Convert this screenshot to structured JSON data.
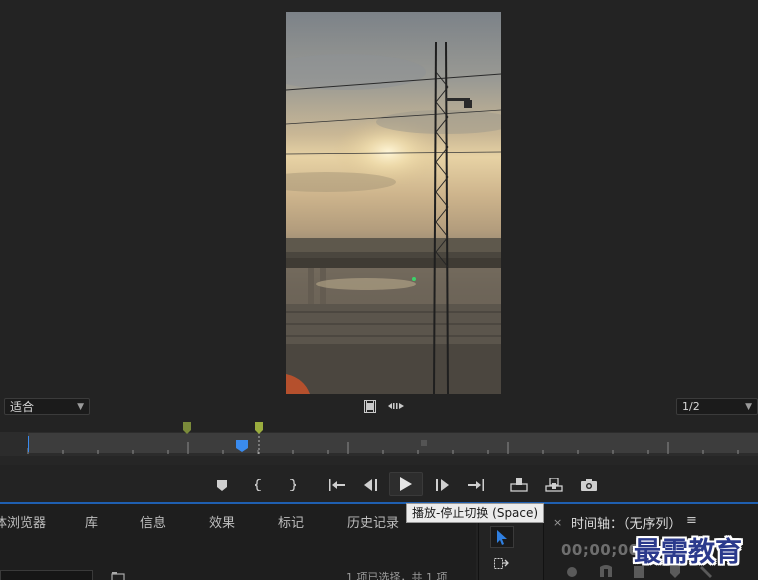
{
  "monitor": {
    "zoom_value": "适合",
    "resolution_value": "1/2"
  },
  "transport": {
    "tooltip": "播放-停止切换 (Space)"
  },
  "project_panel": {
    "tabs": [
      "体浏览器",
      "库",
      "信息",
      "效果",
      "标记",
      "历史记录"
    ],
    "status": "1 项已选择，共 1 项"
  },
  "timeline": {
    "title": "时间轴：（无序列）",
    "menu_glyph": "≡",
    "close_glyph": "×",
    "timecode": "00;00;00;"
  },
  "watermark": "最需教育",
  "colors": {
    "accent_blue": "#2f7fe0",
    "panel_line": "#1f5fb0",
    "marker_green": "#7a8a3a",
    "playhead": "#3a8bee"
  },
  "icons": {
    "add_marker": "marker-icon",
    "mark_in": "mark-in-icon",
    "mark_out": "mark-out-icon",
    "go_to_in": "go-to-in-icon",
    "step_back": "step-back-icon",
    "play": "play-icon",
    "step_forward": "step-forward-icon",
    "go_to_out": "go-to-out-icon",
    "lift": "lift-icon",
    "extract": "extract-icon",
    "export_frame": "camera-icon"
  }
}
